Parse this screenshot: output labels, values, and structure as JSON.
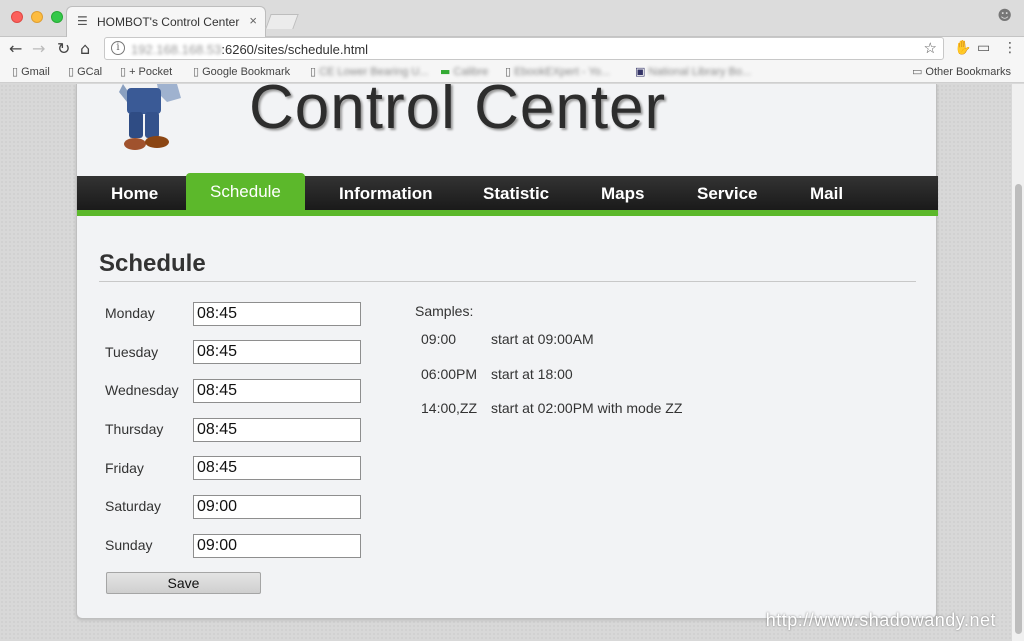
{
  "browser": {
    "tab_title": "HOMBOT's Control Center",
    "tab_close": "×",
    "url_host": "192.168.168.53",
    "url_rest": ":6260/sites/schedule.html",
    "other_bookmarks": "Other Bookmarks",
    "bookmarks": [
      {
        "label": "Gmail"
      },
      {
        "label": "GCal"
      },
      {
        "label": "+ Pocket"
      },
      {
        "label": "Google Bookmark"
      },
      {
        "label": "CE Lower Bearing U..."
      },
      {
        "label": "Calibre"
      },
      {
        "label": "EbookEXpert - Yo..."
      },
      {
        "label": "National Library Bo..."
      }
    ]
  },
  "header": {
    "title": "Control Center"
  },
  "nav": {
    "items": [
      "Home",
      "Schedule",
      "Information",
      "Statistic",
      "Maps",
      "Service",
      "Mail"
    ],
    "active": "Schedule"
  },
  "main": {
    "heading": "Schedule",
    "days": [
      {
        "day": "Monday",
        "time": "08:45"
      },
      {
        "day": "Tuesday",
        "time": "08:45"
      },
      {
        "day": "Wednesday",
        "time": "08:45"
      },
      {
        "day": "Thursday",
        "time": "08:45"
      },
      {
        "day": "Friday",
        "time": "08:45"
      },
      {
        "day": "Saturday",
        "time": "09:00"
      },
      {
        "day": "Sunday",
        "time": "09:00"
      }
    ],
    "save_label": "Save",
    "samples_label": "Samples:",
    "samples": [
      {
        "code": "09:00",
        "desc": "start at 09:00AM"
      },
      {
        "code": "06:00PM",
        "desc": "start at 18:00"
      },
      {
        "code": "14:00,ZZ",
        "desc": "start at 02:00PM with mode ZZ"
      }
    ]
  },
  "watermark": "http://www.shadowandy.net",
  "colors": {
    "accent_green": "#5cb82b",
    "navbar_dark": "#222222"
  }
}
